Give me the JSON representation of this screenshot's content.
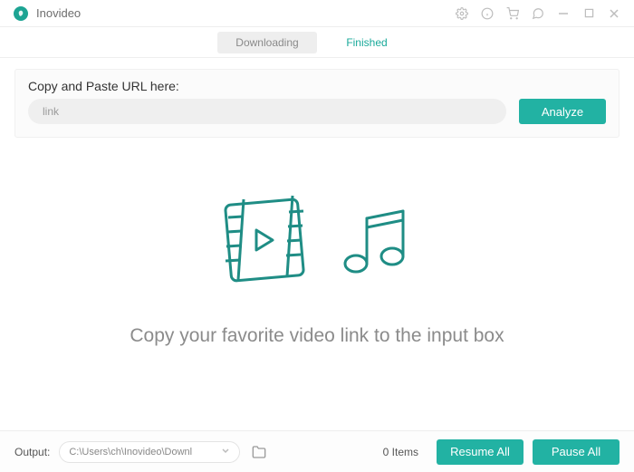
{
  "app": {
    "title": "Inovideo"
  },
  "tabs": {
    "downloading": "Downloading",
    "finished": "Finished"
  },
  "url_panel": {
    "label": "Copy and Paste URL here:",
    "placeholder": "link",
    "value": "",
    "analyze": "Analyze"
  },
  "empty": {
    "message": "Copy your favorite video link to the input box"
  },
  "footer": {
    "output_label": "Output:",
    "output_path": "C:\\Users\\ch\\Inovideo\\Downl",
    "items": "0 Items",
    "resume": "Resume All",
    "pause": "Pause All"
  }
}
